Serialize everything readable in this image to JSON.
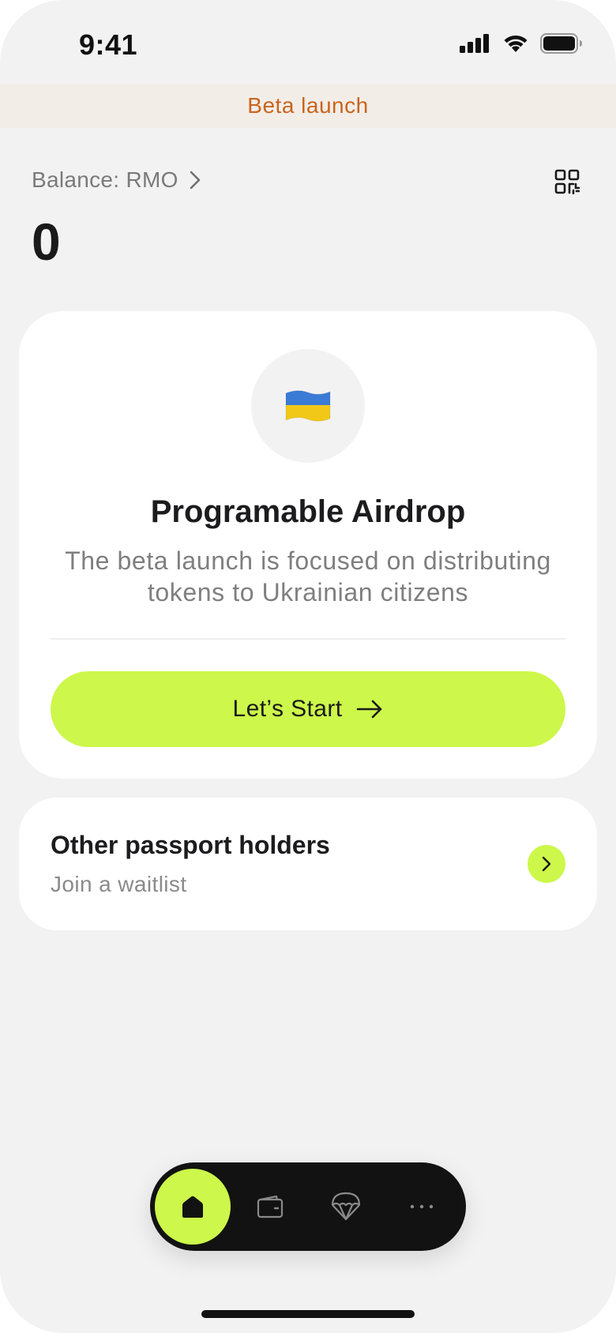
{
  "status_bar": {
    "time": "9:41"
  },
  "banner": {
    "text": "Beta launch",
    "color": "#c9651e"
  },
  "balance": {
    "label": "Balance: RMO",
    "value": "0"
  },
  "airdrop_card": {
    "flag_icon": "ukraine-flag-icon",
    "title": "Programable Airdrop",
    "description": "The beta launch is focused on distributing tokens to Ukrainian citizens",
    "start_button_label": "Let’s Start"
  },
  "waitlist_card": {
    "title": "Other passport holders",
    "subtitle": "Join a waitlist"
  },
  "tab_bar": {
    "items": [
      {
        "icon": "home-icon",
        "active": true
      },
      {
        "icon": "wallet-icon",
        "active": false
      },
      {
        "icon": "parachute-icon",
        "active": false
      },
      {
        "icon": "more-icon",
        "active": false
      }
    ]
  },
  "colors": {
    "accent": "#cdf74a",
    "background": "#f2f2f2",
    "card": "#ffffff",
    "tab_bar": "#121212"
  }
}
